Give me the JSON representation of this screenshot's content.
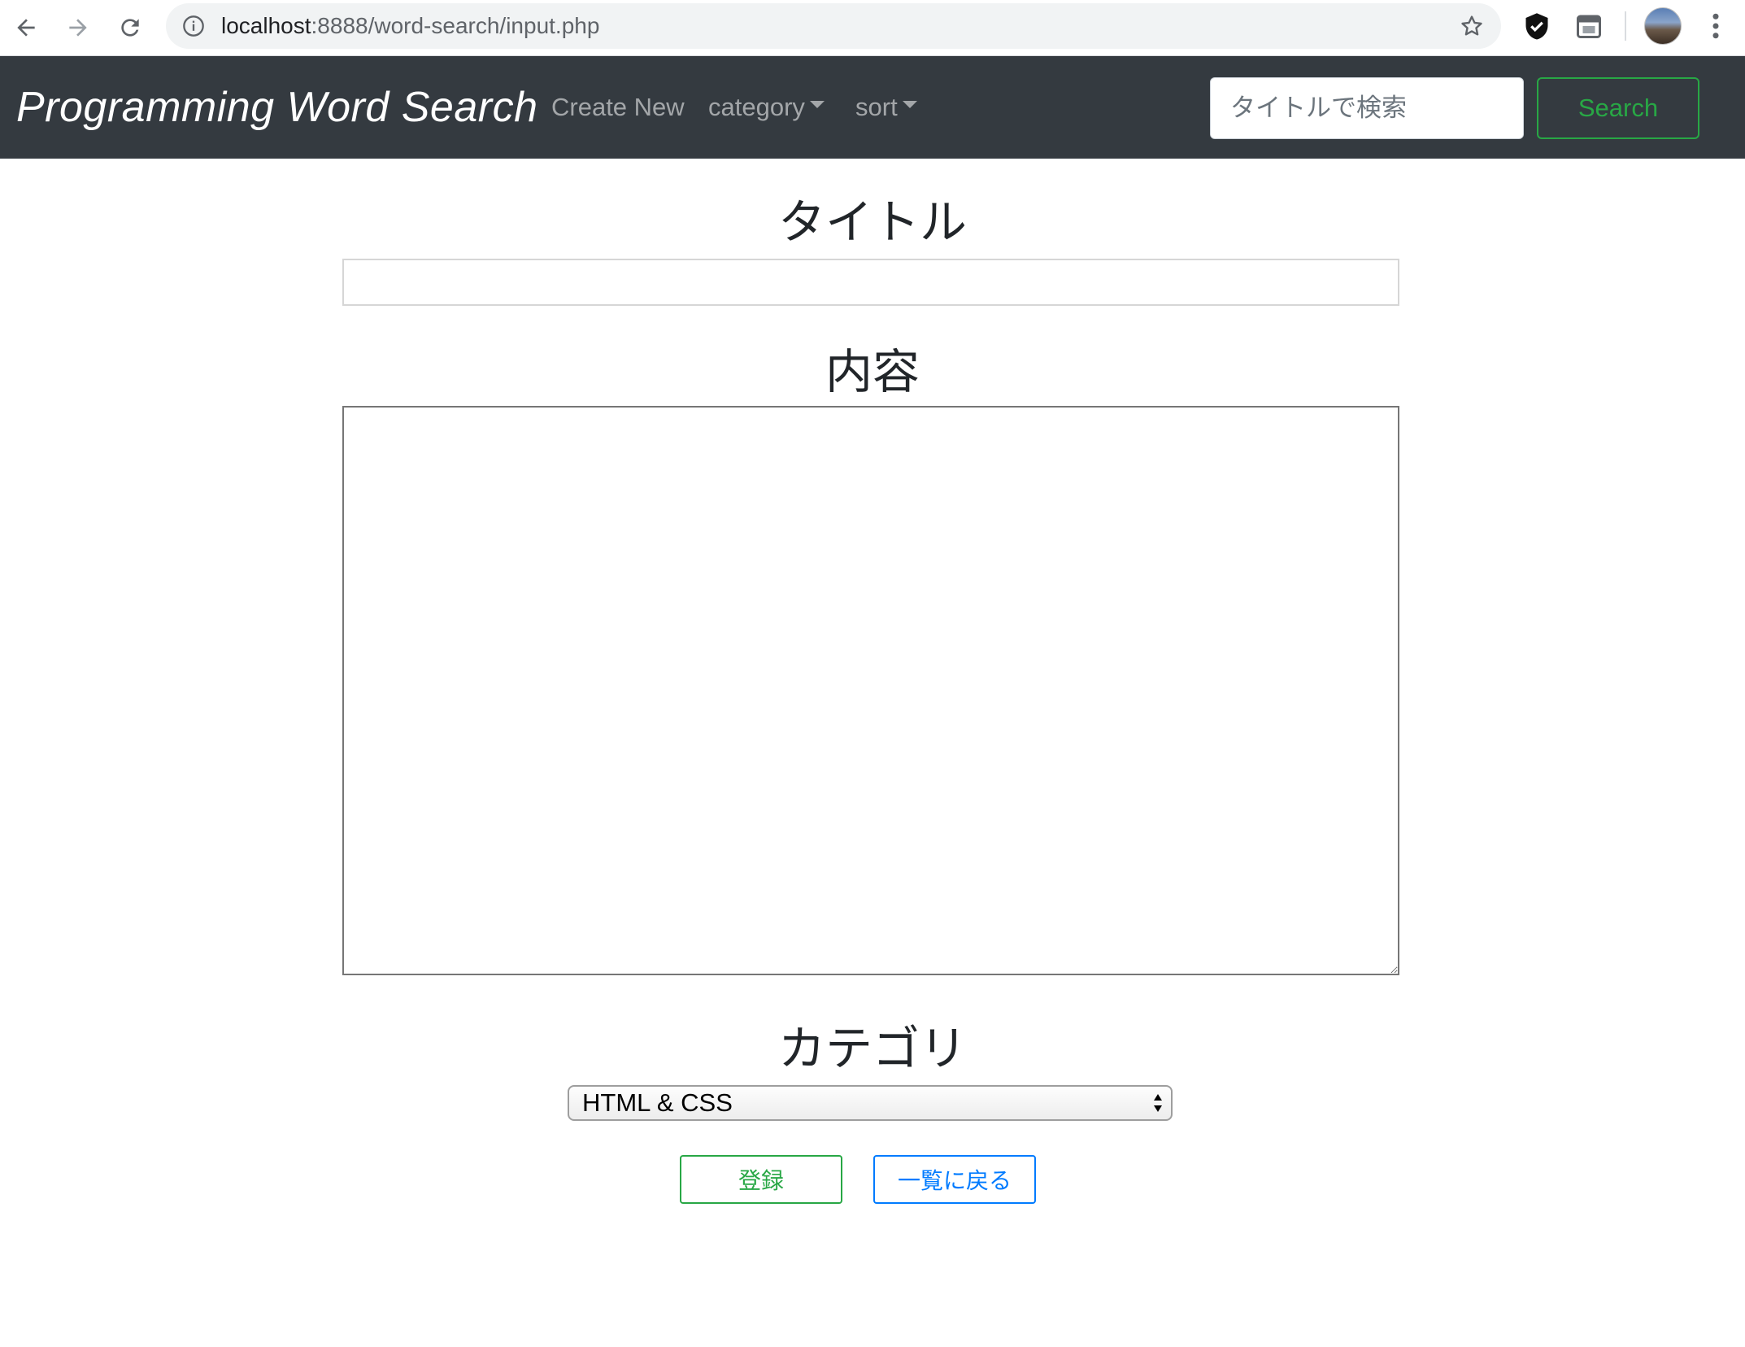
{
  "browser": {
    "url_host": "localhost",
    "url_rest": ":8888/word-search/input.php"
  },
  "navbar": {
    "brand": "Programming Word Search",
    "links": [
      {
        "label": "Create New"
      },
      {
        "label": "category"
      },
      {
        "label": "sort"
      }
    ],
    "search_placeholder": "タイトルで検索",
    "search_button": "Search"
  },
  "form": {
    "title_heading": "タイトル",
    "title_value": "",
    "content_heading": "内容",
    "content_value": "",
    "category_heading": "カテゴリ",
    "category_selected": "HTML & CSS",
    "submit_button": "登録",
    "back_button": "一覧に戻る"
  },
  "colors": {
    "navbar_bg": "#343a40",
    "success": "#28a745",
    "primary": "#007bff"
  }
}
